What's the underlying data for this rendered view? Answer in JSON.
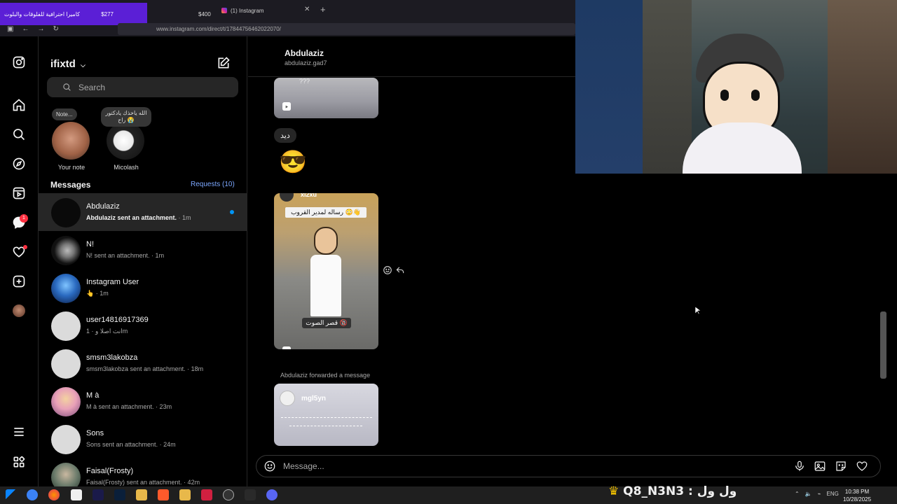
{
  "browser": {
    "ad_text": "كاميرا احترافية للفلوقات والبلوت",
    "ad_price": "$277",
    "ad_price2": "$400",
    "tab_title": "(1) Instagram",
    "url": "www.instagram.com/direct/t/17844756462022070/"
  },
  "rail": {
    "messages_badge": "1"
  },
  "panel": {
    "username": "ifixtd",
    "search_placeholder": "Search",
    "notes": [
      {
        "bubble": "Note...",
        "label": "Your note"
      },
      {
        "bubble": "الله ياخذك يادكتور راح 😭",
        "label": "Micolash"
      }
    ],
    "messages_heading": "Messages",
    "requests": "Requests (10)",
    "conversations": [
      {
        "name": "Abdulaziz",
        "preview": "Abdulaziz sent an attachment.",
        "time": " · 1m",
        "unread": true
      },
      {
        "name": "N!",
        "preview": "N! sent an attachment.",
        "time": " · 1m",
        "unread": false
      },
      {
        "name": "Instagram User",
        "preview": "👆",
        "time": " · 1m",
        "unread": false
      },
      {
        "name": "user14816917369",
        "preview": "انت اصلا و",
        "time": " · 1m",
        "unread": false
      },
      {
        "name": "smsm3lakobza",
        "preview": "smsm3lakobza sent an attachment.",
        "time": " · 18m",
        "unread": false
      },
      {
        "name": "M à",
        "preview": "M à sent an attachment.",
        "time": " · 23m",
        "unread": false
      },
      {
        "name": "Sons",
        "preview": "Sons sent an attachment.",
        "time": " · 24m",
        "unread": false
      },
      {
        "name": "Faisal(Frosty)",
        "preview": "Faisal(Frosty) sent an attachment.",
        "time": " · 42m",
        "unread": false
      }
    ]
  },
  "chat": {
    "name": "Abdulaziz",
    "handle": "abdulaziz.gad7",
    "text_message": "ديد",
    "emoji_message": "😎",
    "reel1_caption": "???",
    "reel2_author": "xl2xu",
    "reel2_top_text": "رساله لمدير القروب 😳👋",
    "reel2_bottom_text": "قصر الصوت 🔞",
    "forwarded_label": "Abdulaziz forwarded a message",
    "reel3_author": "mgl5yn",
    "message_placeholder": "Message..."
  },
  "taskbar": {
    "streamer_tag": "Q8_N3N3 : ول ول",
    "lang": "ENG",
    "time": "10:38 PM",
    "date": "10/28/2025"
  },
  "colors": {
    "accent_blue": "#0095f6",
    "requests_blue": "#7ca8ff",
    "badge_red": "#ff3040",
    "ad_purple": "#5b1fd6"
  }
}
